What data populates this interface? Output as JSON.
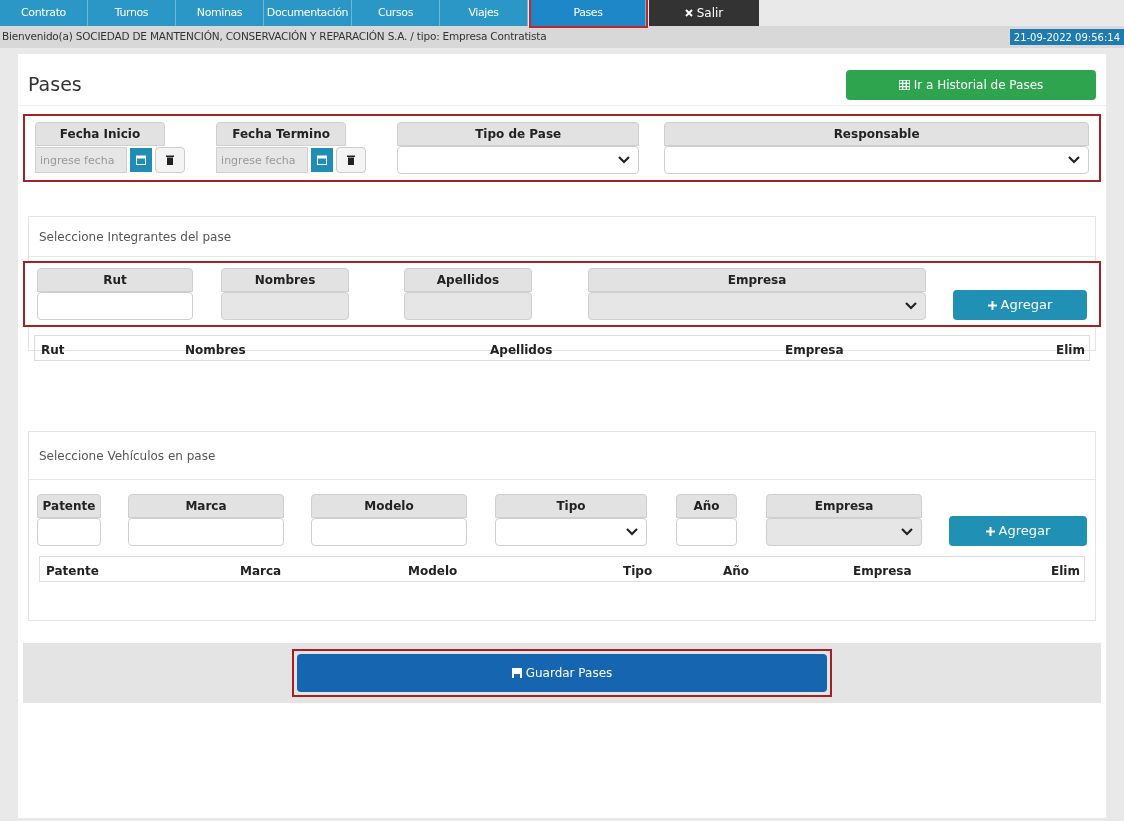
{
  "tabs": [
    {
      "label": "Contrato",
      "selected": false
    },
    {
      "label": "Turnos",
      "selected": false
    },
    {
      "label": "Nominas",
      "selected": false
    },
    {
      "label": "Documentación",
      "selected": false
    },
    {
      "label": "Cursos",
      "selected": false
    },
    {
      "label": "Viajes",
      "selected": false
    },
    {
      "label": "Pases",
      "selected": true
    }
  ],
  "logout": {
    "label": "Salir"
  },
  "welcome": "Bienvenido(a) SOCIEDAD DE MANTENCIÓN, CONSERVACIÓN Y REPARACIÓN S.A. / tipo: Empresa Contratista",
  "datetime": "21-09-2022 09:56:14",
  "page_title": "Pases",
  "history_button": "Ir a Historial de Pases",
  "filters": [
    {
      "kind": "date",
      "label": "Fecha Inicio",
      "placeholder": "ingrese fecha"
    },
    {
      "kind": "date",
      "label": "Fecha Termino",
      "placeholder": "ingrese fecha"
    },
    {
      "kind": "select",
      "label": "Tipo de Pase",
      "disabled": false
    },
    {
      "kind": "select",
      "label": "Responsable",
      "disabled": false
    }
  ],
  "members": {
    "title": "Seleccione Integrantes del pase",
    "fields": [
      {
        "kind": "text",
        "label": "Rut",
        "disabled": false
      },
      {
        "kind": "text",
        "label": "Nombres",
        "disabled": true
      },
      {
        "kind": "text",
        "label": "Apellidos",
        "disabled": true
      },
      {
        "kind": "select",
        "label": "Empresa",
        "disabled": true
      }
    ],
    "add_button": "Agregar",
    "columns": [
      "Rut",
      "Nombres",
      "Apellidos",
      "Empresa",
      "Elim"
    ]
  },
  "vehicles": {
    "title": "Seleccione Vehículos en pase",
    "fields": [
      {
        "kind": "text",
        "label": "Patente",
        "disabled": false
      },
      {
        "kind": "text",
        "label": "Marca",
        "disabled": false
      },
      {
        "kind": "text",
        "label": "Modelo",
        "disabled": false
      },
      {
        "kind": "select",
        "label": "Tipo",
        "disabled": false
      },
      {
        "kind": "text",
        "label": "Año",
        "disabled": false
      },
      {
        "kind": "select",
        "label": "Empresa",
        "disabled": true
      }
    ],
    "add_button": "Agregar",
    "columns": [
      "Patente",
      "Marca",
      "Modelo",
      "Tipo",
      "Año",
      "Empresa",
      "Elim"
    ]
  },
  "save_button": "Guardar Pases"
}
